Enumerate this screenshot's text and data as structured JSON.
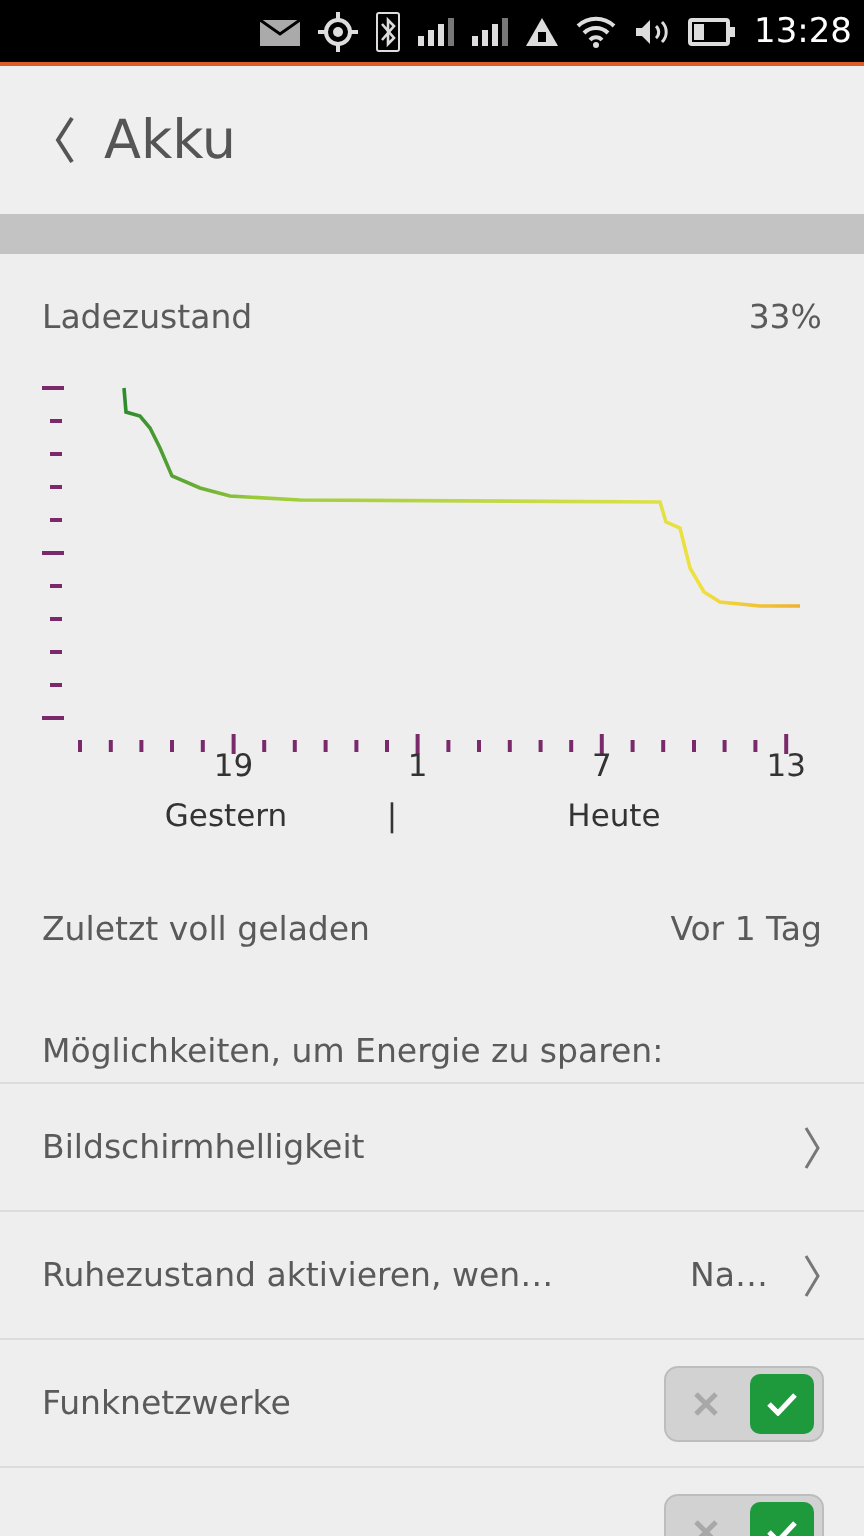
{
  "status_bar": {
    "time": "13:28"
  },
  "header": {
    "title": "Akku"
  },
  "charge": {
    "label": "Ladezustand",
    "value": "33%"
  },
  "chart": {
    "x_labels": [
      "19",
      "1",
      "7",
      "13"
    ],
    "day_labels": [
      "Gestern",
      "Heute"
    ],
    "separator": "|"
  },
  "last_full": {
    "label": "Zuletzt voll geladen",
    "value": "Vor 1 Tag"
  },
  "section_title": "Möglichkeiten, um Energie zu sparen:",
  "items": [
    {
      "kind": "link",
      "label": "Bildschirmhelligkeit"
    },
    {
      "kind": "link",
      "label": "Ruhezustand aktivieren, wen…",
      "value": "Na…"
    },
    {
      "kind": "toggle",
      "label": "Funknetzwerke",
      "on": true
    },
    {
      "kind": "toggle",
      "on": true
    }
  ]
}
